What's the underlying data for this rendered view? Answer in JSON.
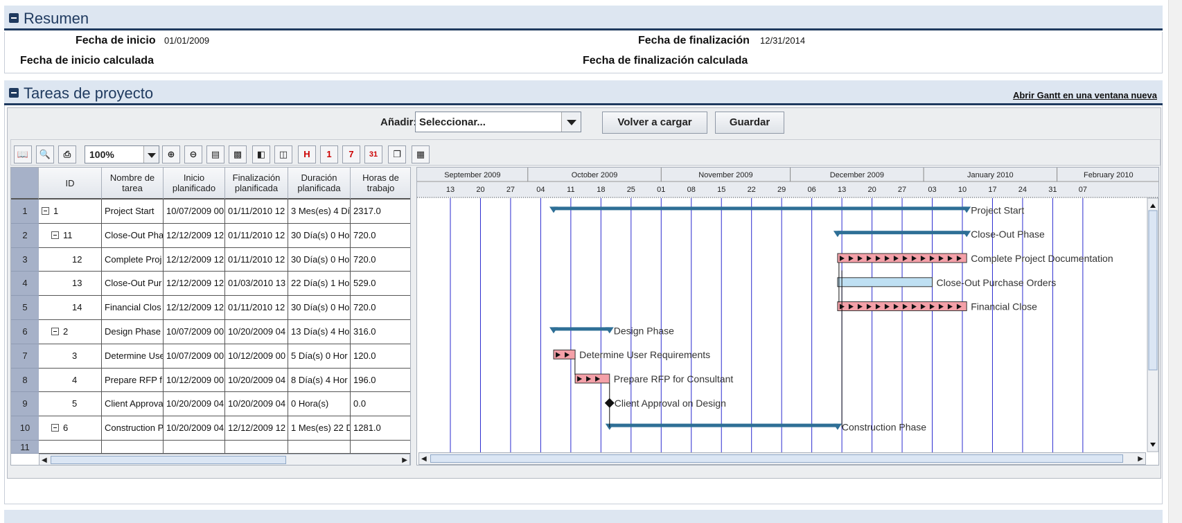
{
  "summary": {
    "title": "Resumen",
    "start_label": "Fecha de inicio",
    "start_value": "01/01/2009",
    "end_label": "Fecha de finalización",
    "end_value": "12/31/2014",
    "calc_start_label": "Fecha de inicio calculada",
    "calc_end_label": "Fecha de finalización calculada"
  },
  "tasks": {
    "title": "Tareas de proyecto",
    "open_gantt_link": "Abrir Gantt en una ventana nueva",
    "add_label": "Añadir:",
    "add_select_value": "Seleccionar...",
    "reload_button": "Volver a cargar",
    "save_button": "Guardar",
    "zoom_value": "100%"
  },
  "grid": {
    "columns": [
      "ID",
      "Nombre de tarea",
      "Inicio planificado",
      "Finalización planificada",
      "Duración planificada",
      "Horas de trabajo"
    ],
    "rows": [
      {
        "num": "1",
        "id": "1",
        "tree": true,
        "indent": 0,
        "name": "Project Start",
        "start": "10/07/2009 00",
        "end": "01/11/2010 12",
        "dur": "3 Mes(es) 4 Dí",
        "hours": "2317.0"
      },
      {
        "num": "2",
        "id": "11",
        "tree": true,
        "indent": 1,
        "name": "Close-Out Pha",
        "start": "12/12/2009 12",
        "end": "01/11/2010 12",
        "dur": "30 Día(s) 0 Ho",
        "hours": "720.0"
      },
      {
        "num": "3",
        "id": "12",
        "tree": false,
        "indent": 2,
        "name": "Complete Proj",
        "start": "12/12/2009 12",
        "end": "01/11/2010 12",
        "dur": "30 Día(s) 0 Ho",
        "hours": "720.0"
      },
      {
        "num": "4",
        "id": "13",
        "tree": false,
        "indent": 2,
        "name": "Close-Out Pur",
        "start": "12/12/2009 12",
        "end": "01/03/2010 13",
        "dur": "22 Día(s) 1 Ho",
        "hours": "529.0"
      },
      {
        "num": "5",
        "id": "14",
        "tree": false,
        "indent": 2,
        "name": "Financial Clos",
        "start": "12/12/2009 12",
        "end": "01/11/2010 12",
        "dur": "30 Día(s) 0 Ho",
        "hours": "720.0"
      },
      {
        "num": "6",
        "id": "2",
        "tree": true,
        "indent": 1,
        "name": "Design Phase",
        "start": "10/07/2009 00",
        "end": "10/20/2009 04",
        "dur": "13 Día(s) 4 Ho",
        "hours": "316.0"
      },
      {
        "num": "7",
        "id": "3",
        "tree": false,
        "indent": 2,
        "name": "Determine Use",
        "start": "10/07/2009 00",
        "end": "10/12/2009 00",
        "dur": "5 Día(s) 0 Hor",
        "hours": "120.0"
      },
      {
        "num": "8",
        "id": "4",
        "tree": false,
        "indent": 2,
        "name": "Prepare RFP f",
        "start": "10/12/2009 00",
        "end": "10/20/2009 04",
        "dur": "8 Día(s) 4 Hor",
        "hours": "196.0"
      },
      {
        "num": "9",
        "id": "5",
        "tree": false,
        "indent": 2,
        "name": "Client Approva",
        "start": "10/20/2009 04",
        "end": "10/20/2009 04",
        "dur": "0 Hora(s)",
        "hours": "0.0"
      },
      {
        "num": "10",
        "id": "6",
        "tree": true,
        "indent": 1,
        "name": "Construction P",
        "start": "10/20/2009 04",
        "end": "12/12/2009 12",
        "dur": "1 Mes(es) 22 D",
        "hours": "1281.0"
      },
      {
        "num": "11",
        "id": "",
        "tree": false,
        "indent": 0,
        "name": "",
        "start": "",
        "end": "",
        "dur": "",
        "hours": ""
      }
    ]
  },
  "gantt": {
    "months": [
      "September 2009",
      "October 2009",
      "November 2009",
      "December 2009",
      "January 2010",
      "February 2010"
    ],
    "days": [
      "13",
      "20",
      "27",
      "04",
      "11",
      "18",
      "25",
      "01",
      "08",
      "15",
      "22",
      "29",
      "06",
      "13",
      "20",
      "27",
      "03",
      "10",
      "17",
      "24",
      "31",
      "07"
    ],
    "bars": [
      {
        "row": 0,
        "type": "summary",
        "start": "2009-10-07",
        "end": "2010-01-11",
        "label": "Project Start"
      },
      {
        "row": 1,
        "type": "summary",
        "start": "2009-12-12",
        "end": "2010-01-11",
        "label": "Close-Out Phase"
      },
      {
        "row": 2,
        "type": "pattern",
        "start": "2009-12-12",
        "end": "2010-01-11",
        "label": "Complete Project Documentation"
      },
      {
        "row": 3,
        "type": "plain",
        "start": "2009-12-12",
        "end": "2010-01-03",
        "label": "Close-Out Purchase Orders"
      },
      {
        "row": 4,
        "type": "pattern",
        "start": "2009-12-12",
        "end": "2010-01-11",
        "label": "Financial Close"
      },
      {
        "row": 5,
        "type": "summary",
        "start": "2009-10-07",
        "end": "2009-10-20",
        "label": "Design Phase"
      },
      {
        "row": 6,
        "type": "pattern",
        "start": "2009-10-07",
        "end": "2009-10-12",
        "label": "Determine User Requirements"
      },
      {
        "row": 7,
        "type": "pattern",
        "start": "2009-10-12",
        "end": "2009-10-20",
        "label": "Prepare RFP for Consultant"
      },
      {
        "row": 8,
        "type": "milestone",
        "start": "2009-10-20",
        "end": "2009-10-20",
        "label": "Client Approval on Design"
      },
      {
        "row": 9,
        "type": "summary",
        "start": "2009-10-20",
        "end": "2009-12-12",
        "label": "Construction Phase"
      }
    ],
    "colors": {
      "summary": "#2e6f96",
      "pattern": "#f4a0a8",
      "plain": "#bfe0f3",
      "gridline": "#2a2acf"
    }
  }
}
